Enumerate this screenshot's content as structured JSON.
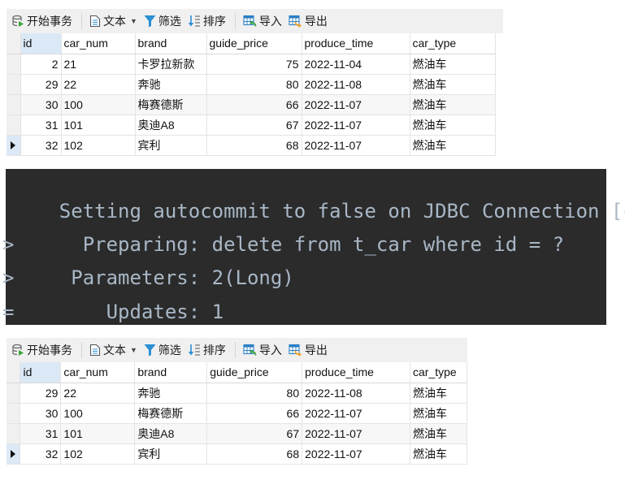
{
  "toolbar": {
    "begin_transaction": "开始事务",
    "text": "文本",
    "filter": "筛选",
    "sort": "排序",
    "import": "导入",
    "export": "导出"
  },
  "columns": [
    "id",
    "car_num",
    "brand",
    "guide_price",
    "produce_time",
    "car_type"
  ],
  "table_before": {
    "rows": [
      {
        "id": "2",
        "car_num": "21",
        "brand": "卡罗拉新款",
        "guide_price": "75",
        "produce_time": "2022-11-04",
        "car_type": "燃油车"
      },
      {
        "id": "29",
        "car_num": "22",
        "brand": "奔驰",
        "guide_price": "80",
        "produce_time": "2022-11-08",
        "car_type": "燃油车"
      },
      {
        "id": "30",
        "car_num": "100",
        "brand": "梅赛德斯",
        "guide_price": "66",
        "produce_time": "2022-11-07",
        "car_type": "燃油车"
      },
      {
        "id": "31",
        "car_num": "101",
        "brand": "奥迪A8",
        "guide_price": "67",
        "produce_time": "2022-11-07",
        "car_type": "燃油车"
      },
      {
        "id": "32",
        "car_num": "102",
        "brand": "宾利",
        "guide_price": "68",
        "produce_time": "2022-11-07",
        "car_type": "燃油车"
      }
    ],
    "current_row": 4
  },
  "console": {
    "lines": [
      {
        "prefix": "",
        "text": "Setting autocommit to false on JDBC Connection [c"
      },
      {
        "prefix": ">",
        "text": "  Preparing: delete from t_car where id = ?"
      },
      {
        "prefix": ">",
        "text": " Parameters: 2(Long)"
      },
      {
        "prefix": "=",
        "text": "    Updates: 1"
      }
    ]
  },
  "table_after": {
    "rows": [
      {
        "id": "29",
        "car_num": "22",
        "brand": "奔驰",
        "guide_price": "80",
        "produce_time": "2022-11-08",
        "car_type": "燃油车"
      },
      {
        "id": "30",
        "car_num": "100",
        "brand": "梅赛德斯",
        "guide_price": "66",
        "produce_time": "2022-11-07",
        "car_type": "燃油车"
      },
      {
        "id": "31",
        "car_num": "101",
        "brand": "奥迪A8",
        "guide_price": "67",
        "produce_time": "2022-11-07",
        "car_type": "燃油车"
      },
      {
        "id": "32",
        "car_num": "102",
        "brand": "宾利",
        "guide_price": "68",
        "produce_time": "2022-11-07",
        "car_type": "燃油车"
      }
    ],
    "current_row": 3
  },
  "colors": {
    "console_bg": "#2b2b2b",
    "console_fg": "#a9b7c6",
    "toolbar_bg": "#f0f0f0",
    "selected_header": "#dbe8f6",
    "icon_blue": "#2b8fd6",
    "icon_green": "#3aa53a",
    "icon_orange": "#f0a020"
  }
}
